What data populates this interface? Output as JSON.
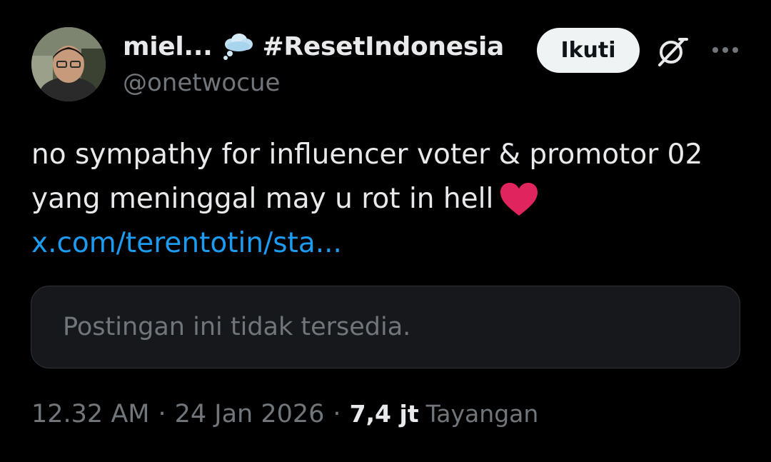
{
  "author": {
    "display_name": "miel...",
    "hashtag": "#ResetIndonesia",
    "handle": "@onetwocue",
    "avatar_icon": "avatar-photo",
    "name_emoji_icon": "thought-cloud-icon"
  },
  "actions": {
    "follow_label": "Ikuti",
    "grok_icon": "grok-icon",
    "more_icon": "more-icon"
  },
  "post": {
    "line1": "no sympathy for influencer voter & promotor 02",
    "line2": "yang meninggal may u rot in hell",
    "heart_icon": "red-heart-icon",
    "link_text": "x.com/terentotin/sta..."
  },
  "quoted": {
    "unavailable_text": "Postingan ini tidak tersedia."
  },
  "meta": {
    "time": "12.32 AM",
    "separator": "·",
    "date": "24 Jan 2026",
    "views_count": "7,4 jt",
    "views_label": "Tayangan"
  },
  "colors": {
    "background": "#000000",
    "text_primary": "#e7e9ea",
    "text_secondary": "#71767b",
    "link": "#1d9bf0",
    "follow_button_bg": "#eff3f4",
    "card_bg": "#16181c",
    "heart": "#e0245e"
  }
}
